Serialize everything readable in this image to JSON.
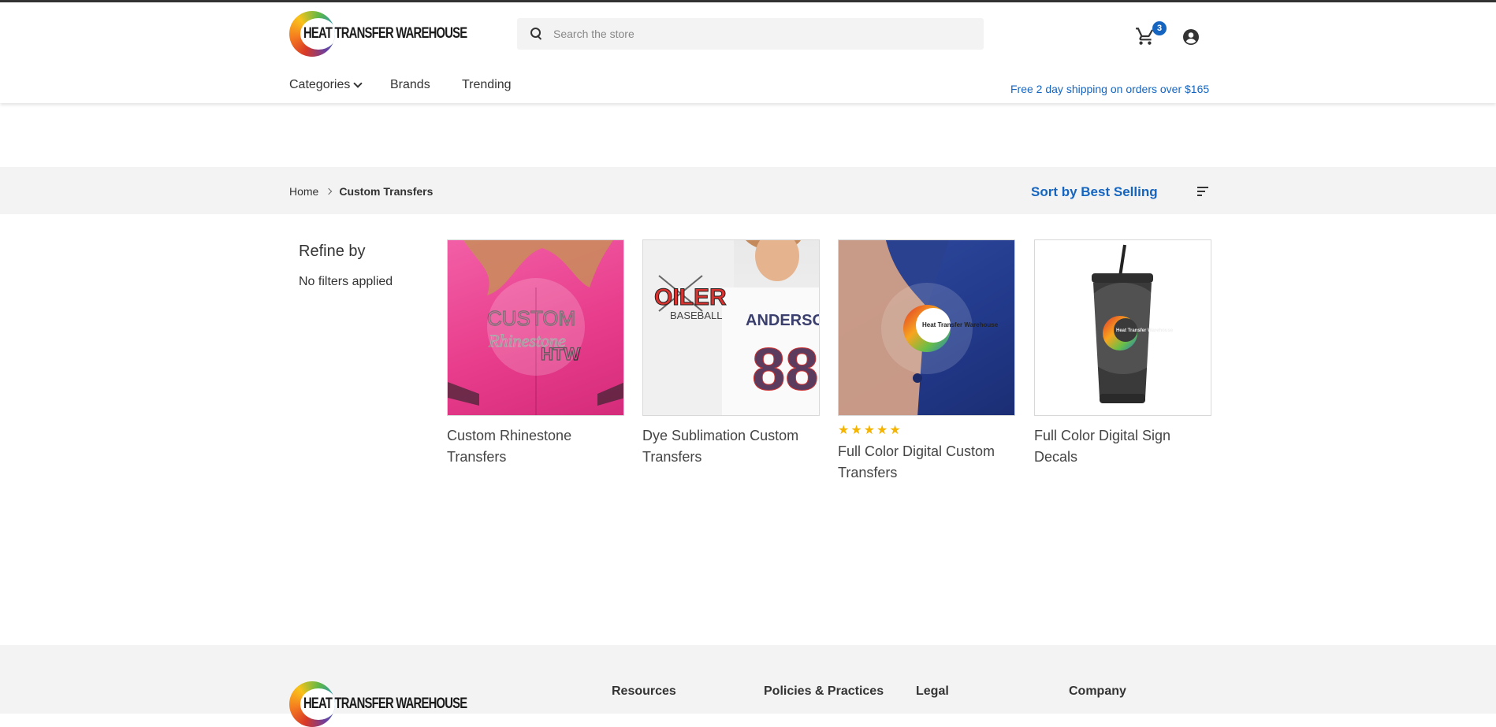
{
  "header": {
    "logo_text": "Heat Transfer Warehouse",
    "search_placeholder": "Search the store",
    "cart_count": "3",
    "nav": [
      {
        "label": "Categories"
      },
      {
        "label": "Brands"
      },
      {
        "label": "Trending"
      }
    ],
    "shipping_notice": "Free 2 day shipping on orders over $165"
  },
  "breadcrumb": {
    "home": "Home",
    "current": "Custom Transfers"
  },
  "sort": {
    "label": "Sort by Best Selling"
  },
  "sidebar": {
    "heading": "Refine by",
    "filters_text": "No filters applied"
  },
  "products": [
    {
      "title": "Custom Rhinestone Transfers",
      "rating": null
    },
    {
      "title": "Dye Sublimation Custom Transfers",
      "rating": null
    },
    {
      "title": "Full Color Digital Custom Transfers",
      "rating": 5
    },
    {
      "title": "Full Color Digital Sign Decals",
      "rating": null
    }
  ],
  "product_images": {
    "p1_text_1": "CUSTOM",
    "p1_text_2": "Rhinestone",
    "p1_text_3": "HTW",
    "p2_text_1": "OILER",
    "p2_text_2": "BASEBALL",
    "p2_text_3": "ANDERSON",
    "p2_text_4": "88"
  },
  "footer": {
    "logo_text": "Heat Transfer Warehouse",
    "columns": [
      "Resources",
      "Policies & Practices",
      "Legal",
      "Company"
    ]
  },
  "colors": {
    "accent": "#1565c0",
    "star": "#f5b400",
    "band": "#f3f3f3"
  },
  "icons": [
    "search-icon",
    "cart-icon",
    "account-icon",
    "chevron-down-icon",
    "chevron-right-icon",
    "sort-icon",
    "star-icon"
  ]
}
